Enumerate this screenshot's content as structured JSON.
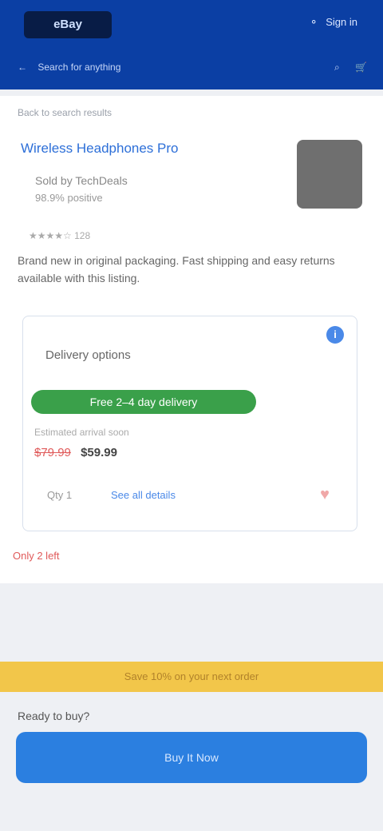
{
  "header": {
    "logo_text": "eBay",
    "right_text": "Sign in",
    "subnav_back": "←",
    "subnav_text": "Search for anything",
    "subnav_icon_search": "⌕",
    "subnav_icon_cart": "🛒"
  },
  "card": {
    "breadcrumb": "Back to search results",
    "product_name": "Wireless Headphones Pro",
    "seller_line1": "Sold by TechDeals",
    "seller_line2": "98.9% positive",
    "rating_text": "★★★★☆ 128",
    "description": "Brand new in original packaging. Fast shipping and easy returns available with this listing."
  },
  "box": {
    "info_icon": "i",
    "label": "Delivery options",
    "deliver_button": "Free 2–4 day delivery",
    "sub_text": "Estimated arrival soon",
    "price_old": "$79.99",
    "price_new": "$59.99",
    "qty_text": "Qty 1",
    "details_link": "See all details",
    "heart_icon": "♥"
  },
  "alert_text": "Only 2 left",
  "promo_text": "Save 10% on your next order",
  "bottom_label": "Ready to buy?",
  "cta_label": "Buy It Now",
  "colors": {
    "header": "#0b3fa4",
    "accent": "#2b7fe0",
    "success": "#3aa04a",
    "promo": "#f2c64a",
    "alert": "#e05a5a"
  }
}
